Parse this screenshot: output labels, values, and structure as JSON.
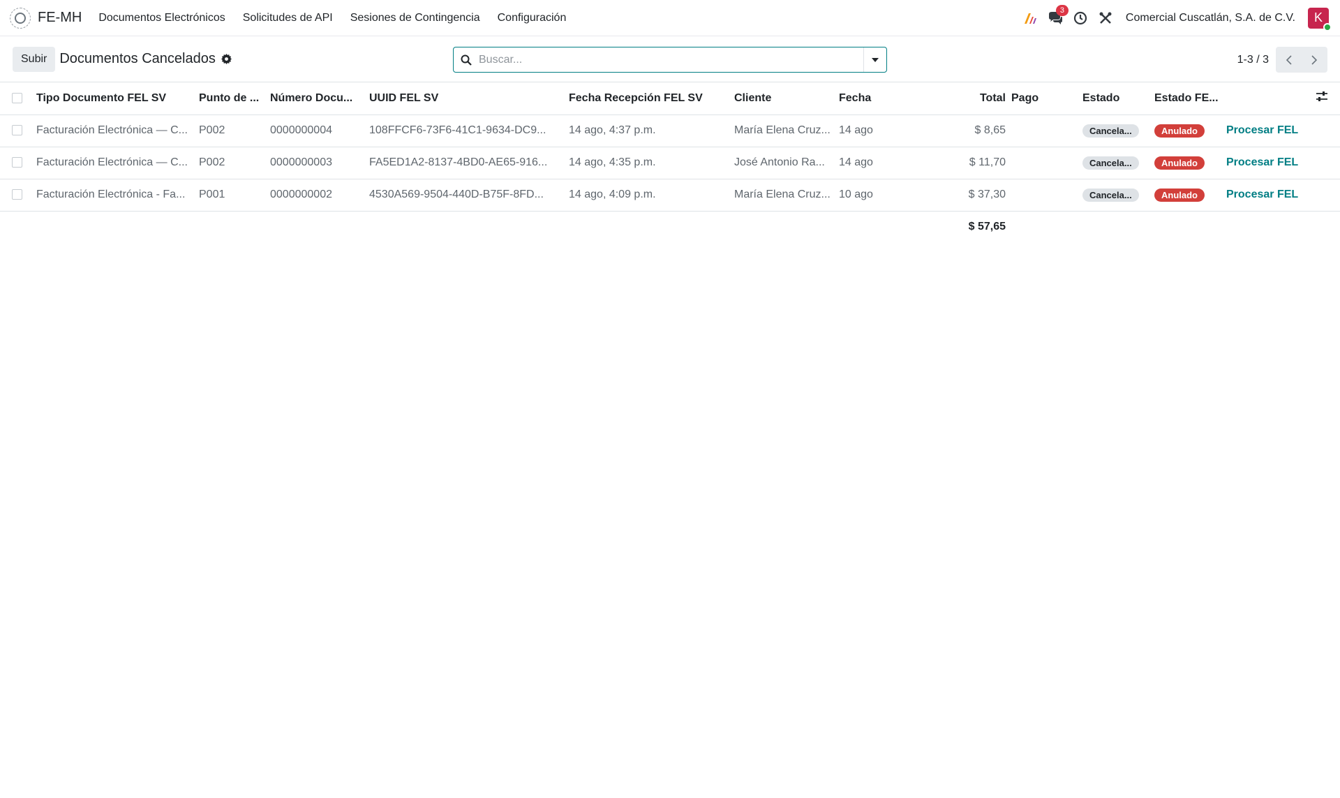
{
  "navbar": {
    "app_name": "FE-MH",
    "menu": [
      {
        "label": "Documentos Electrónicos"
      },
      {
        "label": "Solicitudes de API"
      },
      {
        "label": "Sesiones de Contingencia"
      },
      {
        "label": "Configuración"
      }
    ],
    "messages_badge": "3",
    "company": "Comercial Cuscatlán, S.A. de C.V.",
    "avatar_letter": "K"
  },
  "control": {
    "upload_label": "Subir",
    "title": "Documentos Cancelados",
    "search_placeholder": "Buscar...",
    "pager": "1-3 / 3"
  },
  "table": {
    "headers": {
      "tipo": "Tipo Documento FEL SV",
      "punto": "Punto de ...",
      "numero": "Número Docu...",
      "uuid": "UUID FEL SV",
      "fecha_recepcion": "Fecha Recepción FEL SV",
      "cliente": "Cliente",
      "fecha": "Fecha",
      "total": "Total",
      "pago": "Pago",
      "estado": "Estado",
      "estado_fel": "Estado FE..."
    },
    "rows": [
      {
        "tipo": "Facturación Electrónica — C...",
        "punto": "P002",
        "numero": "0000000004",
        "uuid": "108FFCF6-73F6-41C1-9634-DC9...",
        "fecha_recepcion": "14 ago, 4:37 p.m.",
        "cliente": "María Elena Cruz...",
        "fecha": "14 ago",
        "total": "$ 8,65",
        "pago": "",
        "estado": "Cancela...",
        "estado_fel": "Anulado",
        "action": "Procesar FEL"
      },
      {
        "tipo": "Facturación Electrónica — C...",
        "punto": "P002",
        "numero": "0000000003",
        "uuid": "FA5ED1A2-8137-4BD0-AE65-916...",
        "fecha_recepcion": "14 ago, 4:35 p.m.",
        "cliente": "José Antonio Ra...",
        "fecha": "14 ago",
        "total": "$ 11,70",
        "pago": "",
        "estado": "Cancela...",
        "estado_fel": "Anulado",
        "action": "Procesar FEL"
      },
      {
        "tipo": "Facturación Electrónica - Fa...",
        "punto": "P001",
        "numero": "0000000002",
        "uuid": "4530A569-9504-440D-B75F-8FD...",
        "fecha_recepcion": "14 ago, 4:09 p.m.",
        "cliente": "María Elena Cruz...",
        "fecha": "10 ago",
        "total": "$ 37,30",
        "pago": "",
        "estado": "Cancela...",
        "estado_fel": "Anulado",
        "action": "Procesar FEL"
      }
    ],
    "footer_total": "$ 57,65"
  },
  "colors": {
    "accent": "#017e84",
    "danger_badge": "#d23f3a",
    "avatar": "#c7254e"
  }
}
